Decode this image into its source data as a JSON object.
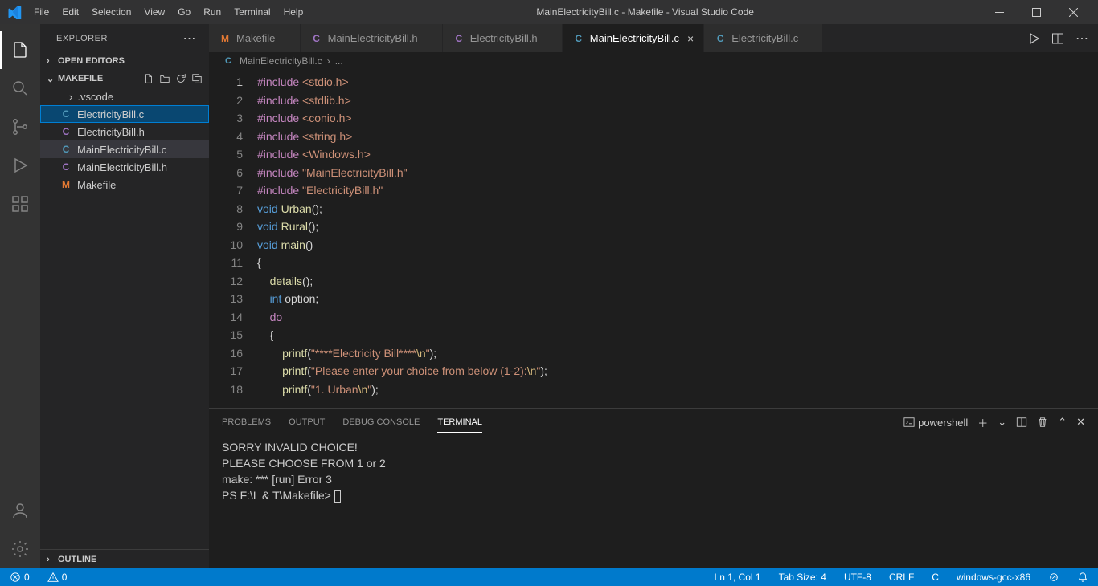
{
  "window": {
    "title": "MainElectricityBill.c - Makefile - Visual Studio Code"
  },
  "menubar": [
    "File",
    "Edit",
    "Selection",
    "View",
    "Go",
    "Run",
    "Terminal",
    "Help"
  ],
  "sidebar": {
    "title": "EXPLORER",
    "open_editors": "OPEN EDITORS",
    "project": "MAKEFILE",
    "folder": ".vscode",
    "files": [
      {
        "icon": "C",
        "cls": "c",
        "name": "ElectricityBill.c"
      },
      {
        "icon": "C",
        "cls": "cp",
        "name": "ElectricityBill.h"
      },
      {
        "icon": "C",
        "cls": "c",
        "name": "MainElectricityBill.c"
      },
      {
        "icon": "C",
        "cls": "cp",
        "name": "MainElectricityBill.h"
      },
      {
        "icon": "M",
        "cls": "m",
        "name": "Makefile"
      }
    ],
    "outline": "OUTLINE"
  },
  "tabs": [
    {
      "icon": "M",
      "cls": "m",
      "label": "Makefile"
    },
    {
      "icon": "C",
      "cls": "cp",
      "label": "MainElectricityBill.h"
    },
    {
      "icon": "C",
      "cls": "cp",
      "label": "ElectricityBill.h"
    },
    {
      "icon": "C",
      "cls": "c",
      "label": "MainElectricityBill.c",
      "active": true
    },
    {
      "icon": "C",
      "cls": "c",
      "label": "ElectricityBill.c"
    }
  ],
  "breadcrumb": {
    "icon": "C",
    "file": "MainElectricityBill.c",
    "rest": "..."
  },
  "code_lines": [
    [
      [
        "kw",
        "#include"
      ],
      [
        "punc",
        " "
      ],
      [
        "str",
        "<stdio.h>"
      ]
    ],
    [
      [
        "kw",
        "#include"
      ],
      [
        "punc",
        " "
      ],
      [
        "str",
        "<stdlib.h>"
      ]
    ],
    [
      [
        "kw",
        "#include"
      ],
      [
        "punc",
        " "
      ],
      [
        "str",
        "<conio.h>"
      ]
    ],
    [
      [
        "kw",
        "#include"
      ],
      [
        "punc",
        " "
      ],
      [
        "str",
        "<string.h>"
      ]
    ],
    [
      [
        "kw",
        "#include"
      ],
      [
        "punc",
        " "
      ],
      [
        "str",
        "<Windows.h>"
      ]
    ],
    [
      [
        "kw",
        "#include"
      ],
      [
        "punc",
        " "
      ],
      [
        "str",
        "\"MainElectricityBill.h\""
      ]
    ],
    [
      [
        "kw",
        "#include"
      ],
      [
        "punc",
        " "
      ],
      [
        "str",
        "\"ElectricityBill.h\""
      ]
    ],
    [
      [
        "type",
        "void"
      ],
      [
        "punc",
        " "
      ],
      [
        "fn",
        "Urban"
      ],
      [
        "punc",
        "();"
      ]
    ],
    [
      [
        "type",
        "void"
      ],
      [
        "punc",
        " "
      ],
      [
        "fn",
        "Rural"
      ],
      [
        "punc",
        "();"
      ]
    ],
    [
      [
        "type",
        "void"
      ],
      [
        "punc",
        " "
      ],
      [
        "fn",
        "main"
      ],
      [
        "punc",
        "()"
      ]
    ],
    [
      [
        "punc",
        "{"
      ]
    ],
    [
      [
        "punc",
        "    "
      ],
      [
        "fn",
        "details"
      ],
      [
        "punc",
        "();"
      ]
    ],
    [
      [
        "punc",
        "    "
      ],
      [
        "type",
        "int"
      ],
      [
        "punc",
        " option;"
      ]
    ],
    [
      [
        "punc",
        "    "
      ],
      [
        "kw",
        "do"
      ]
    ],
    [
      [
        "punc",
        "    {"
      ]
    ],
    [
      [
        "punc",
        "        "
      ],
      [
        "fn",
        "printf"
      ],
      [
        "punc",
        "("
      ],
      [
        "str",
        "\"****Electricity Bill****"
      ],
      [
        "esc",
        "\\n"
      ],
      [
        "str",
        "\""
      ],
      [
        "punc",
        ");"
      ]
    ],
    [
      [
        "punc",
        "        "
      ],
      [
        "fn",
        "printf"
      ],
      [
        "punc",
        "("
      ],
      [
        "str",
        "\"Please enter your choice from below (1-2):"
      ],
      [
        "esc",
        "\\n"
      ],
      [
        "str",
        "\""
      ],
      [
        "punc",
        ");"
      ]
    ],
    [
      [
        "punc",
        "        "
      ],
      [
        "fn",
        "printf"
      ],
      [
        "punc",
        "("
      ],
      [
        "str",
        "\"1. Urban"
      ],
      [
        "esc",
        "\\n"
      ],
      [
        "str",
        "\""
      ],
      [
        "punc",
        ");"
      ]
    ]
  ],
  "panel": {
    "tabs": [
      "PROBLEMS",
      "OUTPUT",
      "DEBUG CONSOLE",
      "TERMINAL"
    ],
    "shell": "powershell",
    "lines": [
      "SORRY INVALID CHOICE!",
      "PLEASE CHOOSE FROM 1 or 2",
      "make: *** [run] Error 3",
      "PS F:\\L & T\\Makefile> "
    ]
  },
  "statusbar": {
    "errors": "0",
    "warnings": "0",
    "cursor": "Ln 1, Col 1",
    "tabsize": "Tab Size: 4",
    "encoding": "UTF-8",
    "eol": "CRLF",
    "lang": "C",
    "kit": "windows-gcc-x86"
  }
}
